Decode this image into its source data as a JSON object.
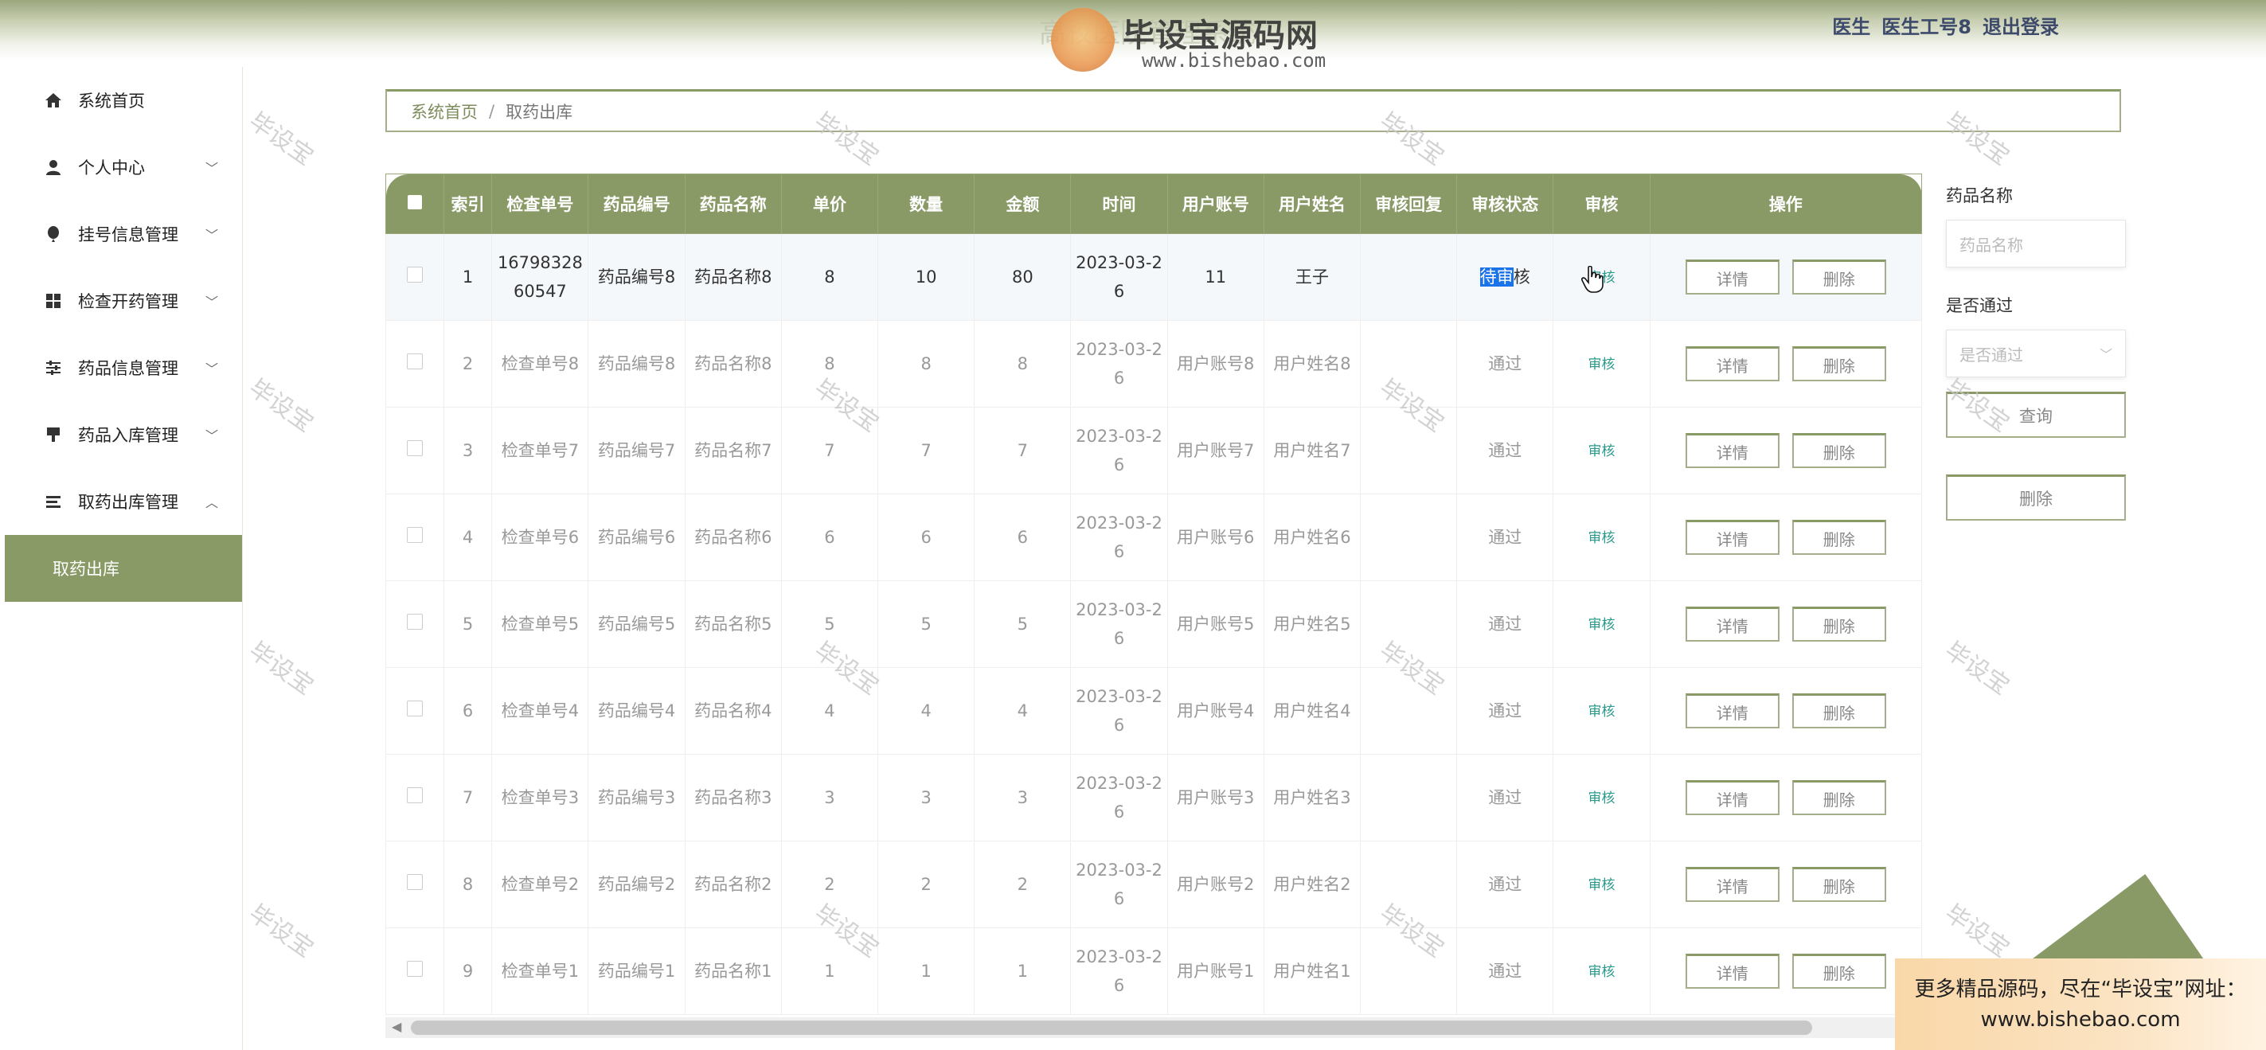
{
  "header": {
    "title_ghost": "高校医院管理系统",
    "role": "医生",
    "username": "医生工号8",
    "logout": "退出登录",
    "logo_text": "毕设宝源码网",
    "logo_url": "www.bishebao.com"
  },
  "sidebar": {
    "items": [
      {
        "label": "系统首页",
        "icon": "home-icon"
      },
      {
        "label": "个人中心",
        "icon": "user-icon"
      },
      {
        "label": "挂号信息管理",
        "icon": "balloon-icon"
      },
      {
        "label": "检查开药管理",
        "icon": "grid-icon"
      },
      {
        "label": "药品信息管理",
        "icon": "sliders-icon"
      },
      {
        "label": "药品入库管理",
        "icon": "brush-icon"
      },
      {
        "label": "取药出库管理",
        "icon": "list-icon"
      }
    ],
    "sub_active": "取药出库"
  },
  "breadcrumb": {
    "home": "系统首页",
    "separator": "/",
    "current": "取药出库"
  },
  "table": {
    "headers": [
      "索引",
      "检查单号",
      "药品编号",
      "药品名称",
      "单价",
      "数量",
      "金额",
      "时间",
      "用户账号",
      "用户姓名",
      "审核回复",
      "审核状态",
      "审核",
      "操作"
    ],
    "rows": [
      {
        "idx": "1",
        "check": "1679832860547",
        "drug_no": "药品编号8",
        "drug_name": "药品名称8",
        "price": "8",
        "qty": "10",
        "amount": "80",
        "time": "2023-03-26",
        "account": "11",
        "name": "王子",
        "reply": "",
        "status_hl": "待审",
        "status_rest": "核",
        "audit": "审核"
      },
      {
        "idx": "2",
        "check": "检查单号8",
        "drug_no": "药品编号8",
        "drug_name": "药品名称8",
        "price": "8",
        "qty": "8",
        "amount": "8",
        "time": "2023-03-26",
        "account": "用户账号8",
        "name": "用户姓名8",
        "reply": "",
        "status": "通过",
        "audit": "审核"
      },
      {
        "idx": "3",
        "check": "检查单号7",
        "drug_no": "药品编号7",
        "drug_name": "药品名称7",
        "price": "7",
        "qty": "7",
        "amount": "7",
        "time": "2023-03-26",
        "account": "用户账号7",
        "name": "用户姓名7",
        "reply": "",
        "status": "通过",
        "audit": "审核"
      },
      {
        "idx": "4",
        "check": "检查单号6",
        "drug_no": "药品编号6",
        "drug_name": "药品名称6",
        "price": "6",
        "qty": "6",
        "amount": "6",
        "time": "2023-03-26",
        "account": "用户账号6",
        "name": "用户姓名6",
        "reply": "",
        "status": "通过",
        "audit": "审核"
      },
      {
        "idx": "5",
        "check": "检查单号5",
        "drug_no": "药品编号5",
        "drug_name": "药品名称5",
        "price": "5",
        "qty": "5",
        "amount": "5",
        "time": "2023-03-26",
        "account": "用户账号5",
        "name": "用户姓名5",
        "reply": "",
        "status": "通过",
        "audit": "审核"
      },
      {
        "idx": "6",
        "check": "检查单号4",
        "drug_no": "药品编号4",
        "drug_name": "药品名称4",
        "price": "4",
        "qty": "4",
        "amount": "4",
        "time": "2023-03-26",
        "account": "用户账号4",
        "name": "用户姓名4",
        "reply": "",
        "status": "通过",
        "audit": "审核"
      },
      {
        "idx": "7",
        "check": "检查单号3",
        "drug_no": "药品编号3",
        "drug_name": "药品名称3",
        "price": "3",
        "qty": "3",
        "amount": "3",
        "time": "2023-03-26",
        "account": "用户账号3",
        "name": "用户姓名3",
        "reply": "",
        "status": "通过",
        "audit": "审核"
      },
      {
        "idx": "8",
        "check": "检查单号2",
        "drug_no": "药品编号2",
        "drug_name": "药品名称2",
        "price": "2",
        "qty": "2",
        "amount": "2",
        "time": "2023-03-26",
        "account": "用户账号2",
        "name": "用户姓名2",
        "reply": "",
        "status": "通过",
        "audit": "审核"
      },
      {
        "idx": "9",
        "check": "检查单号1",
        "drug_no": "药品编号1",
        "drug_name": "药品名称1",
        "price": "1",
        "qty": "1",
        "amount": "1",
        "time": "2023-03-26",
        "account": "用户账号1",
        "name": "用户姓名1",
        "reply": "",
        "status": "通过",
        "audit": "审核"
      }
    ],
    "detail_btn": "详情",
    "delete_btn": "删除"
  },
  "filter": {
    "drug_name_label": "药品名称",
    "drug_name_placeholder": "药品名称",
    "pass_label": "是否通过",
    "pass_placeholder": "是否通过",
    "query_btn": "查询",
    "delete_btn": "删除"
  },
  "watermark": "毕设宝",
  "promo": {
    "line1": "更多精品源码，尽在“毕设宝”网址：",
    "line2": "www.bishebao.com"
  },
  "colors": {
    "accent": "#8a9a67",
    "audit_link": "#2a9a8a",
    "highlight": "#1a73e8"
  }
}
